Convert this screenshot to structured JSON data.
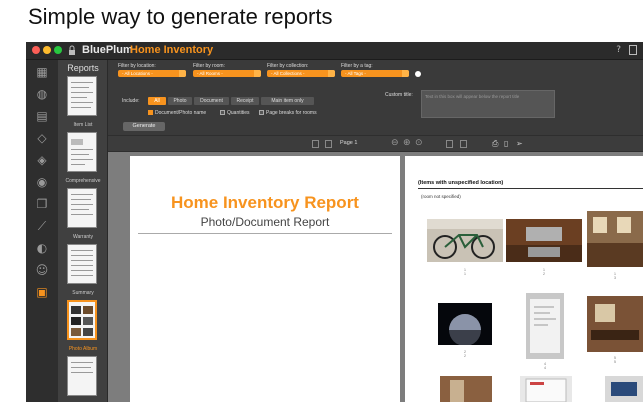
{
  "caption": "Simple way to generate reports",
  "window": {
    "brand": "BluePlum",
    "product": "Home Inventory",
    "help": "?"
  },
  "reports_panel": {
    "title": "Reports",
    "items": [
      {
        "label": "Item List"
      },
      {
        "label": "Comprehensive"
      },
      {
        "label": "Warranty"
      },
      {
        "label": "Summary"
      },
      {
        "label": "Photo Album",
        "active": true
      }
    ]
  },
  "filters": {
    "location": {
      "label": "Filter by location:",
      "value": "- All Locations -"
    },
    "room": {
      "label": "Filter by room:",
      "value": "- All Rooms -"
    },
    "collection": {
      "label": "Filter by collection:",
      "value": "- All Collections -"
    },
    "tag": {
      "label": "Filter by  a tag:",
      "value": "- All Tags -"
    }
  },
  "custom_title": {
    "label": "Custom title:",
    "placeholder": "Text in this box will appear below the report title"
  },
  "include": {
    "label": "Include:",
    "options": [
      "All",
      "Photo",
      "Document",
      "Receipt",
      "Main item only"
    ],
    "active": "All"
  },
  "checkboxes": [
    {
      "label": "Document/Photo name",
      "checked": true
    },
    {
      "label": "Quantities",
      "checked": false
    },
    {
      "label": "Page breaks for rooms",
      "checked": false
    }
  ],
  "generate_button": "Generate",
  "toolbar": {
    "page_label": "Page  1"
  },
  "page1": {
    "title": "Home Inventory Report",
    "subtitle": "Photo/Document Report"
  },
  "page2": {
    "heading": "(Items with unspecified location)",
    "subheading": "(room not specified)",
    "captions": [
      "1\n1",
      "1\n2",
      "1\n3",
      "2\n2",
      "4\n4",
      "5\n5"
    ]
  },
  "colors": {
    "accent": "#f7931e",
    "window_bg": "#3a3a3a"
  }
}
